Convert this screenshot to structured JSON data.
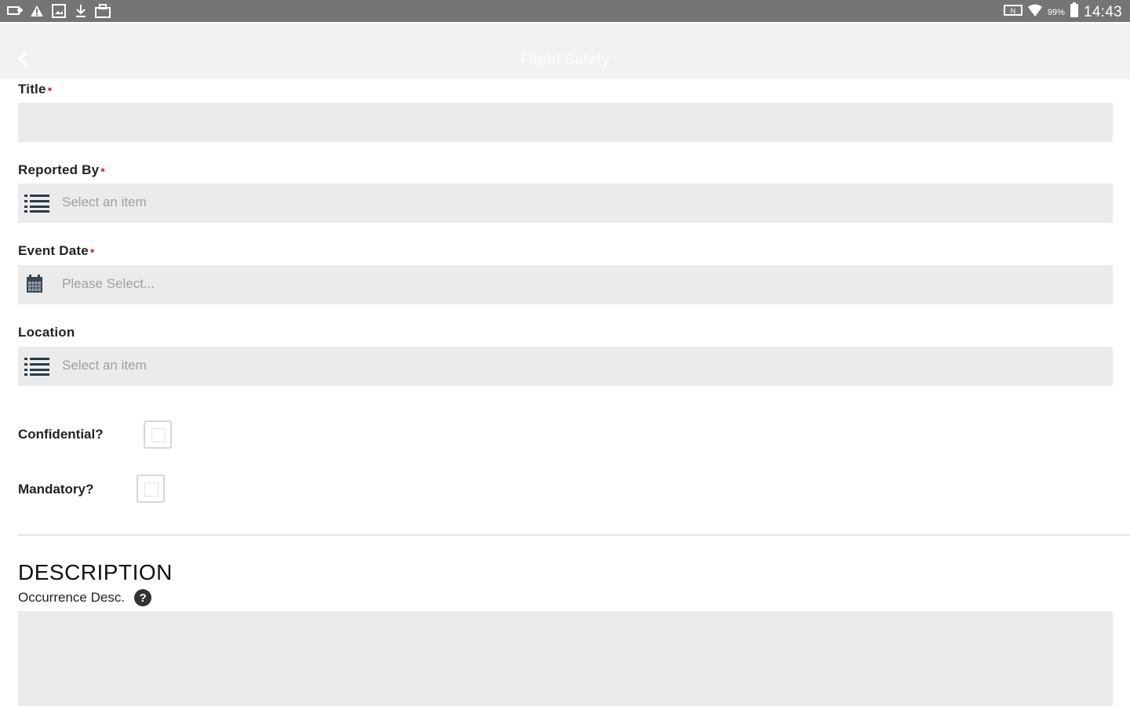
{
  "status_bar": {
    "left_icons": [
      "cast-icon",
      "warning-icon",
      "image-icon",
      "download-icon",
      "briefcase-icon"
    ],
    "battery": "99%",
    "time": "14:43"
  },
  "app_bar": {
    "title": "Flight Safety",
    "back_icon": "chevron-left-icon"
  },
  "form": {
    "title": {
      "label": "Title",
      "required_mark": "•",
      "value": ""
    },
    "reported_by": {
      "label": "Reported By",
      "required_mark": "•",
      "placeholder": "Select an item"
    },
    "event_date": {
      "label": "Event Date",
      "required_mark": "•",
      "placeholder": "Please Select..."
    },
    "location": {
      "label": "Location",
      "placeholder": "Select an item"
    },
    "confidential": {
      "label": "Confidential?",
      "checked": false
    },
    "mandatory": {
      "label": "Mandatory?",
      "checked": false
    }
  },
  "description": {
    "section_title": "DESCRIPTION",
    "occurrence_label": "Occurrence Desc.",
    "help_glyph": "?",
    "value": ""
  },
  "colors": {
    "status_bar": "#757575",
    "app_bar": "#f2f2f2",
    "field_bg": "#ebebeb",
    "required": "#e53935"
  }
}
